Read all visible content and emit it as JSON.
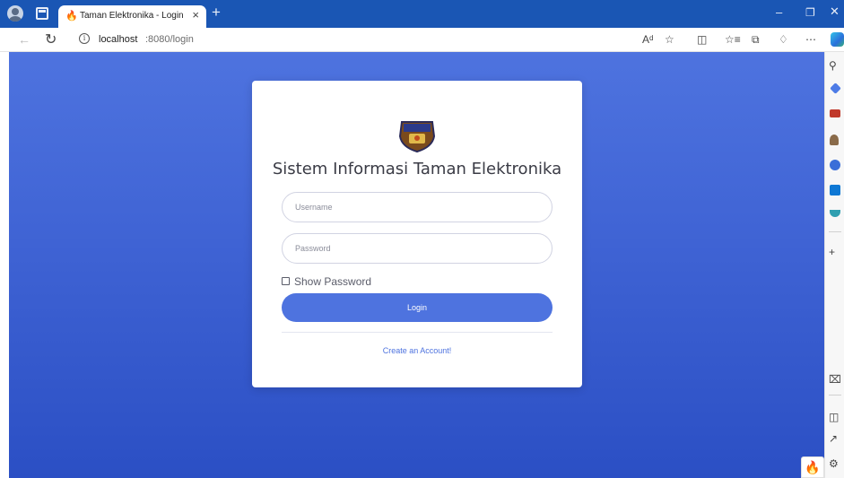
{
  "browser": {
    "tab_title": "Taman Elektronika - Login",
    "url_host": "localhost",
    "url_path": ":8080/login",
    "new_tab": "+",
    "tab_close": "×",
    "window_min": "–",
    "window_restore": "❐",
    "window_close": "✕"
  },
  "login": {
    "heading": "Sistem Informasi Taman Elektronika",
    "username_placeholder": "Username",
    "password_placeholder": "Password",
    "show_password_label": "Show Password",
    "login_button": "Login",
    "create_account_link": "Create an Account!"
  },
  "icons": {
    "tab_favicon": "flame-icon",
    "logo": "shield-emblem-icon",
    "sidebar": [
      "search-icon",
      "shopping-tag-icon",
      "toolbox-icon",
      "games-icon",
      "office-icon",
      "outlook-icon",
      "drop-icon",
      "add-icon",
      "screenshot-icon",
      "sidebar-toggle-icon",
      "external-icon",
      "settings-icon"
    ]
  },
  "colors": {
    "primary": "#4e73df",
    "titlebar": "#1a56b4",
    "text": "#3a3b45"
  }
}
